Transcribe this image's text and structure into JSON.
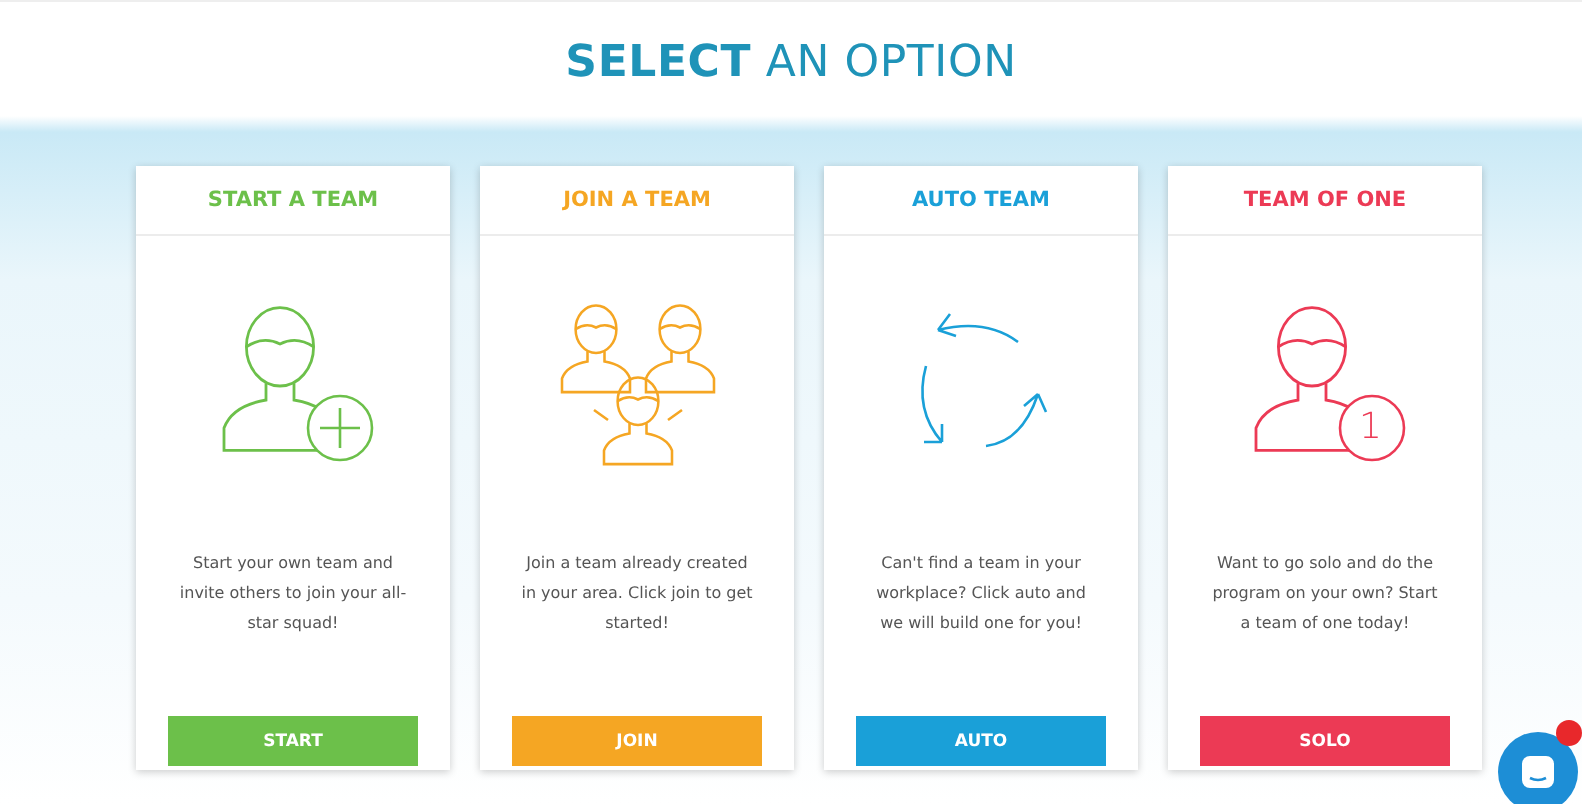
{
  "heading": "**SELECT** AN OPTION",
  "options": [
    {
      "kind": "add-person",
      "title": "START A TEAM",
      "color": "#6cc04a",
      "description": "Start your own team and invite others to join your all-star squad!",
      "button": "START"
    },
    {
      "kind": "group",
      "title": "JOIN A TEAM",
      "color": "#f5a623",
      "description": "Join a team already created in your area. Click join to get started!",
      "button": "JOIN"
    },
    {
      "kind": "cycle",
      "title": "AUTO TEAM",
      "color": "#1aa0d8",
      "description": "Can't find a team in your workplace? Click auto and we will build one for you!",
      "button": "AUTO"
    },
    {
      "kind": "solo",
      "title": "TEAM OF ONE",
      "color": "#ec3a55",
      "description": "Want to go solo and do the program on your own? Start a team of one today!",
      "button": "SOLO",
      "badge": "1"
    }
  ],
  "chat": {
    "unread": true
  }
}
